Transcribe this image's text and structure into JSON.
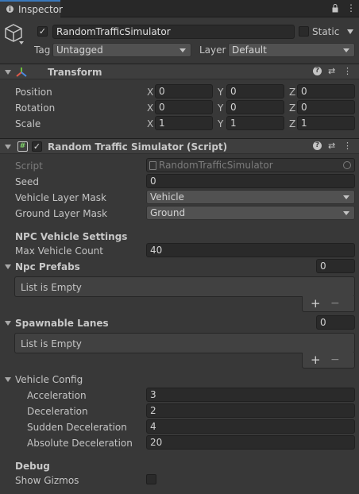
{
  "tab": {
    "title": "Inspector"
  },
  "object": {
    "enabled": true,
    "name": "RandomTrafficSimulator",
    "static_label": "Static",
    "static": false,
    "tag_label": "Tag",
    "tag_value": "Untagged",
    "layer_label": "Layer",
    "layer_value": "Default"
  },
  "transform": {
    "title": "Transform",
    "rows": [
      {
        "label": "Position",
        "x": "0",
        "y": "0",
        "z": "0"
      },
      {
        "label": "Rotation",
        "x": "0",
        "y": "0",
        "z": "0"
      },
      {
        "label": "Scale",
        "x": "1",
        "y": "1",
        "z": "1"
      }
    ],
    "axis": {
      "x": "X",
      "y": "Y",
      "z": "Z"
    }
  },
  "script_component": {
    "title": "Random Traffic Simulator (Script)",
    "script_label": "Script",
    "script_value": "RandomTrafficSimulator",
    "seed_label": "Seed",
    "seed_value": "0",
    "vehicle_mask_label": "Vehicle Layer Mask",
    "vehicle_mask_value": "Vehicle",
    "ground_mask_label": "Ground Layer Mask",
    "ground_mask_value": "Ground",
    "npc_header": "NPC Vehicle Settings",
    "max_count_label": "Max Vehicle Count",
    "max_count_value": "40",
    "npc_prefabs": {
      "label": "Npc Prefabs",
      "count": "0",
      "empty": "List is Empty"
    },
    "spawnable_lanes": {
      "label": "Spawnable Lanes",
      "count": "0",
      "empty": "List is Empty"
    },
    "vehicle_config": {
      "label": "Vehicle Config",
      "rows": [
        {
          "label": "Acceleration",
          "value": "3"
        },
        {
          "label": "Deceleration",
          "value": "2"
        },
        {
          "label": "Sudden Deceleration",
          "value": "4"
        },
        {
          "label": "Absolute Deceleration",
          "value": "20"
        }
      ]
    },
    "debug_header": "Debug",
    "show_gizmos_label": "Show Gizmos",
    "show_gizmos": false
  },
  "icons": {
    "add": "+",
    "remove": "−",
    "help": "?",
    "presets": "⇄",
    "more": "⋮"
  }
}
